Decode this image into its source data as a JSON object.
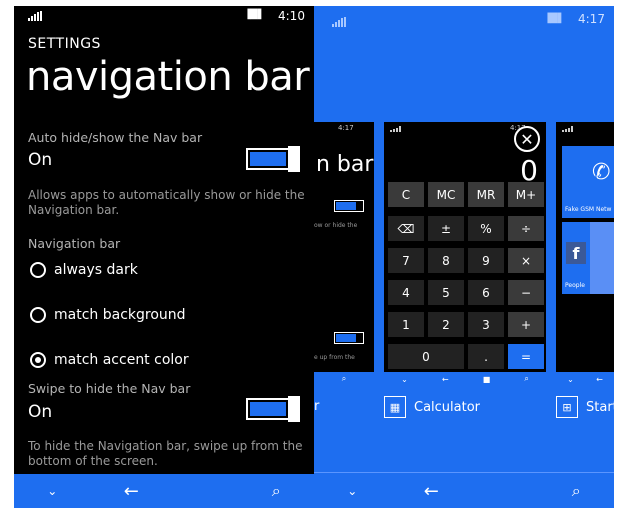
{
  "left_phone": {
    "status": {
      "time": "4:10"
    },
    "header": "SETTINGS",
    "title": "navigation bar",
    "auto_hide": {
      "label": "Auto hide/show the Nav bar",
      "state": "On",
      "description": "Allows apps to automatically show or hide the Navigation bar."
    },
    "nav_bar_section": {
      "label": "Navigation bar",
      "options": [
        "always dark",
        "match background",
        "match accent color"
      ],
      "selected": "match accent color"
    },
    "swipe_hide": {
      "label": "Swipe to hide the Nav bar",
      "state": "On",
      "description": "To hide the Navigation bar, swipe up from the bottom of the screen."
    }
  },
  "right_phone": {
    "status": {
      "time": "4:17"
    },
    "cards": {
      "settings_card": {
        "time": "4:17",
        "title_fragment": "n bar",
        "desc_fragment": "ow or hide the",
        "bottom_fragment": "e up from the",
        "label_fragment": "r"
      },
      "calculator": {
        "time": "4:17",
        "display": "0",
        "keys": [
          "C",
          "MC",
          "MR",
          "M+",
          "⌫",
          "±",
          "%",
          "÷",
          "7",
          "8",
          "9",
          "×",
          "4",
          "5",
          "6",
          "−",
          "1",
          "2",
          "3",
          "+",
          "0",
          ".",
          "="
        ],
        "label": "Calculator"
      },
      "start": {
        "tiles": [
          "Fake GSM Netw",
          "People"
        ],
        "label": "Start"
      }
    }
  },
  "colors": {
    "accent": "#1e6ef0",
    "background": "#000000"
  },
  "icons": [
    "chevron-down-icon",
    "back-arrow-icon",
    "windows-icon",
    "search-icon",
    "close-icon",
    "calculator-icon",
    "phone-icon",
    "facebook-icon"
  ]
}
